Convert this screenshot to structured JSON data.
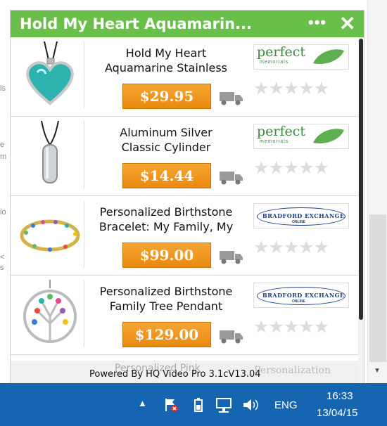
{
  "popup": {
    "title": "Hold My Heart Aquamarin...",
    "more_icon": "ellipsis-icon",
    "close_icon": "close-icon",
    "items": [
      {
        "name_line1": "Hold My Heart",
        "name_line2": "Aquamarine Stainless",
        "price": "$29.95",
        "vendor": "perfect",
        "vendor_sub": "memorials",
        "rating_stars": 0
      },
      {
        "name_line1": "Aluminum Silver",
        "name_line2": "Classic Cylinder",
        "price": "$14.44",
        "vendor": "perfect",
        "vendor_sub": "memorials",
        "rating_stars": 0
      },
      {
        "name_line1": "Personalized Birthstone",
        "name_line2": "Bracelet: My Family, My",
        "price": "$99.00",
        "vendor": "BRADFORD EXCHANGE",
        "vendor_sub": "ONLINE",
        "rating_stars": 0
      },
      {
        "name_line1": "Personalized Birthstone",
        "name_line2": "Family Tree Pendant",
        "price": "$129.00",
        "vendor": "BRADFORD EXCHANGE",
        "vendor_sub": "ONLINE",
        "rating_stars": 0
      }
    ],
    "partial_item": {
      "name": "Personalized Pink",
      "vendor": "Personalization"
    },
    "powered_by": "Powered By HQ Video Pro 3.1cV13.04"
  },
  "taskbar": {
    "language": "ENG",
    "time": "16:33",
    "date": "13/04/15",
    "tray_icons": [
      "show-hidden-icons-icon",
      "action-center-flag-icon",
      "power-icon",
      "network-icon",
      "volume-icon"
    ]
  },
  "colors": {
    "title_bar": "#6abf4b",
    "price_button": "#f29a1e",
    "taskbar": "#1565b0"
  }
}
